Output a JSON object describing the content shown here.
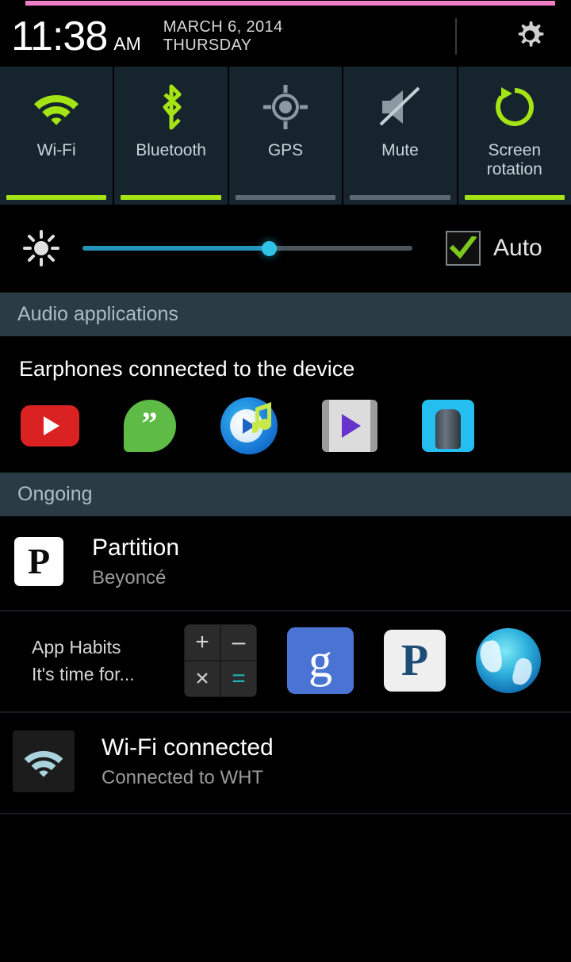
{
  "status": {
    "progress_color": "#F07FC8",
    "time": "11:38",
    "ampm": "AM",
    "date": "MARCH 6, 2014",
    "weekday": "THURSDAY",
    "settings_icon": "gear-icon"
  },
  "quick_settings": {
    "toggles": [
      {
        "label": "Wi-Fi",
        "icon": "wifi-icon",
        "active": true
      },
      {
        "label": "Bluetooth",
        "icon": "bluetooth-icon",
        "active": true
      },
      {
        "label": "GPS",
        "icon": "gps-icon",
        "active": false
      },
      {
        "label": "Mute",
        "icon": "mute-icon",
        "active": false
      },
      {
        "label": "Screen\nrotation",
        "label_line1": "Screen",
        "label_line2": "rotation",
        "icon": "screen-rotation-icon",
        "active": true
      }
    ],
    "active_color": "#A4E314",
    "inactive_color": "#5E6A71"
  },
  "brightness": {
    "icon": "brightness-icon",
    "value_percent": 57,
    "fill_color": "#2393B8",
    "track_color": "#4C565C",
    "knob_color": "#31C2E8",
    "auto_label": "Auto",
    "auto_checked": true,
    "check_color": "#7DC81E"
  },
  "sections": {
    "audio": {
      "header": "Audio applications",
      "message": "Earphones connected to the device",
      "apps": [
        {
          "name": "youtube-icon",
          "label": "YouTube"
        },
        {
          "name": "hangouts-icon",
          "label": "Hangouts"
        },
        {
          "name": "music-player-icon",
          "label": "Music Player"
        },
        {
          "name": "video-player-icon",
          "label": "Video Player"
        },
        {
          "name": "voice-recorder-icon",
          "label": "Voice Recorder"
        }
      ]
    },
    "ongoing": {
      "header": "Ongoing",
      "media": {
        "icon": "pandora-icon",
        "title": "Partition",
        "subtitle": "Beyoncé"
      },
      "habits": {
        "title": "App Habits",
        "subtitle": "It's time for...",
        "suggestions": [
          {
            "name": "calculator-icon",
            "label": "Calculator"
          },
          {
            "name": "google-search-icon",
            "label": "Google"
          },
          {
            "name": "pandora-icon",
            "label": "Pandora"
          },
          {
            "name": "internet-browser-icon",
            "label": "Internet"
          }
        ],
        "calculator_keys": [
          "+",
          "–",
          "×",
          "="
        ]
      },
      "wifi": {
        "icon": "wifi-status-icon",
        "title": "Wi-Fi connected",
        "subtitle": "Connected to WHT"
      }
    }
  }
}
